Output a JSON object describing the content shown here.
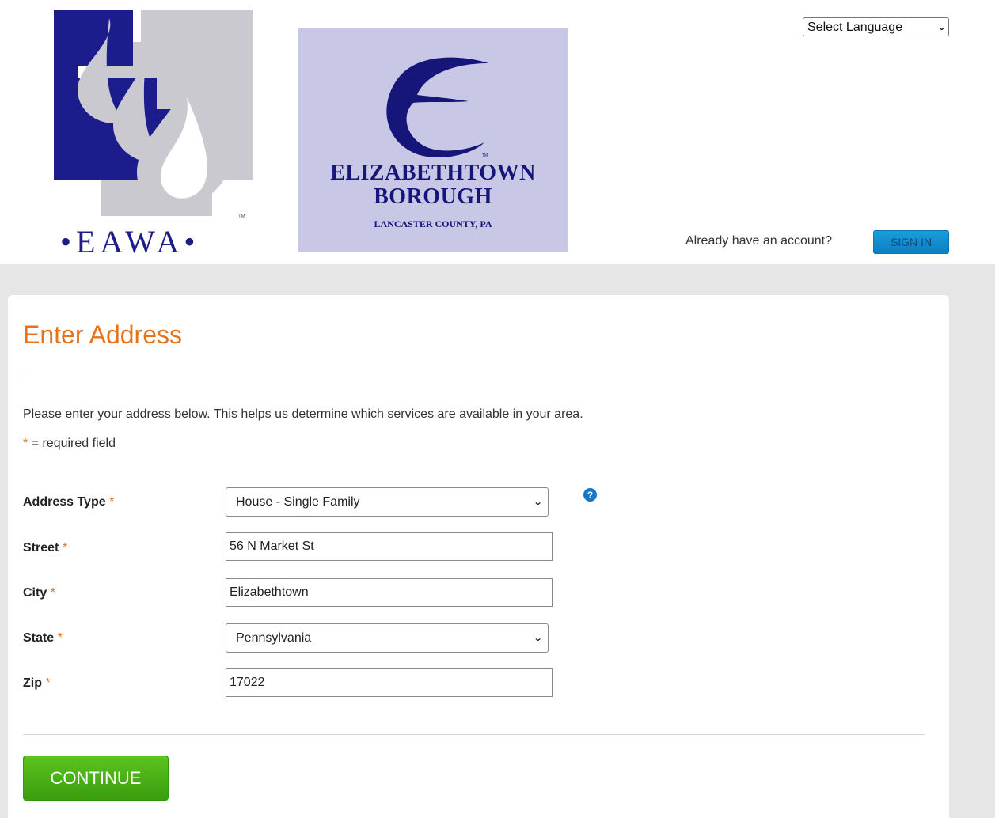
{
  "header": {
    "logo_eawa_text": "EAWA",
    "logo_borough": {
      "line1": "ELIZABETHTOWN",
      "line2": "BOROUGH",
      "line3": "LANCASTER COUNTY, PA"
    },
    "language_select": "Select Language",
    "already_text": "Already have an account?",
    "signin_label": "SIGN IN"
  },
  "form": {
    "title": "Enter Address",
    "intro": "Please enter your address below. This helps us determine which services are available in your area.",
    "required_marker": "*",
    "required_note": " = required field",
    "fields": {
      "address_type": {
        "label": "Address Type",
        "value": "House - Single Family"
      },
      "street": {
        "label": "Street",
        "value": "56 N Market St"
      },
      "city": {
        "label": "City",
        "value": "Elizabethtown"
      },
      "state": {
        "label": "State",
        "value": "Pennsylvania"
      },
      "zip": {
        "label": "Zip",
        "value": "17022"
      }
    },
    "help_icon": "question-icon",
    "continue_label": "CONTINUE"
  },
  "colors": {
    "accent_orange": "#e8731a",
    "signin_blue": "#1a9ddc",
    "continue_green": "#4cb318",
    "borough_bg": "#c8c8e6",
    "eawa_navy": "#1c1c8c"
  }
}
